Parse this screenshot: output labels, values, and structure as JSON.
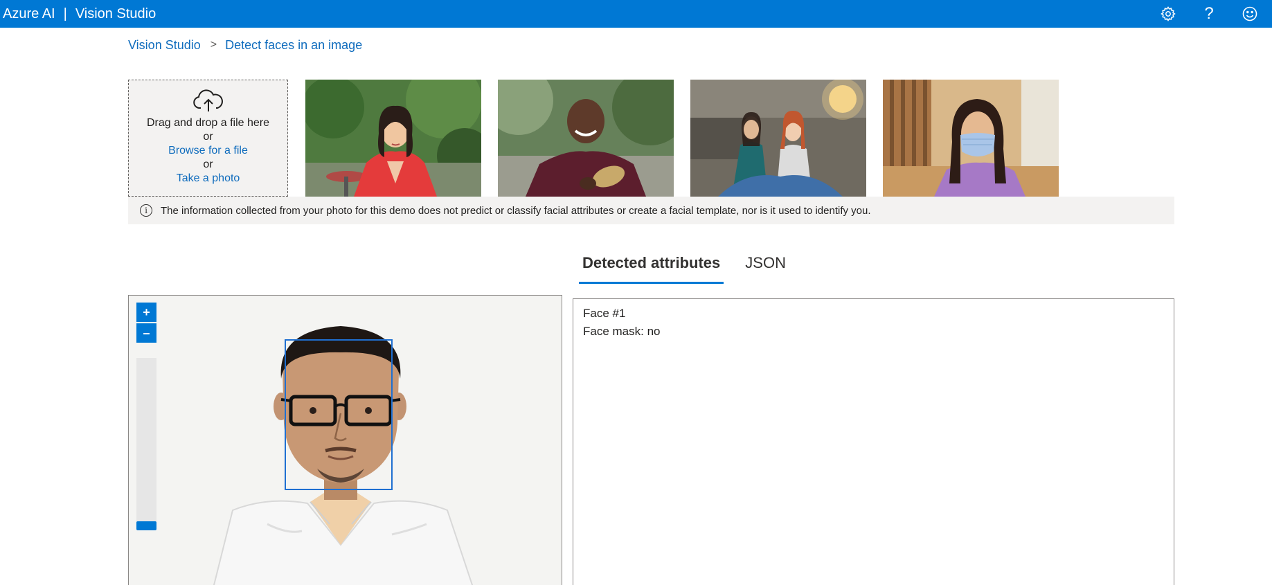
{
  "header": {
    "brand": "Azure AI",
    "separator": "|",
    "product": "Vision Studio",
    "icons": [
      "gear-icon",
      "help-icon",
      "feedback-smiley-icon"
    ],
    "accent_color": "#0078d4"
  },
  "breadcrumb": {
    "home": "Vision Studio",
    "chevron": ">",
    "current": "Detect faces in an image"
  },
  "upload": {
    "icon": "cloud-upload-icon",
    "drag_text": "Drag and drop a file here",
    "or1": "or",
    "browse_link": "Browse for a file",
    "or2": "or",
    "photo_link": "Take a photo"
  },
  "samples": [
    {
      "id": "sample-1",
      "description": "woman in red top outdoors"
    },
    {
      "id": "sample-2",
      "description": "smiling man holding mask"
    },
    {
      "id": "sample-3",
      "description": "two women with fabric"
    },
    {
      "id": "sample-4",
      "description": "woman wearing face mask"
    }
  ],
  "notice": {
    "icon": "info-icon",
    "text": "The information collected from your photo for this demo does not predict or classify facial attributes or create a facial template, nor is it used to identify you."
  },
  "tabs": [
    {
      "label": "Detected attributes",
      "active": true
    },
    {
      "label": "JSON",
      "active": false
    }
  ],
  "viewer": {
    "zoom_in": "+",
    "zoom_out": "–",
    "zoom_level": 0
  },
  "results": {
    "face_title": "Face #1",
    "mask_label": "Face mask: no"
  }
}
